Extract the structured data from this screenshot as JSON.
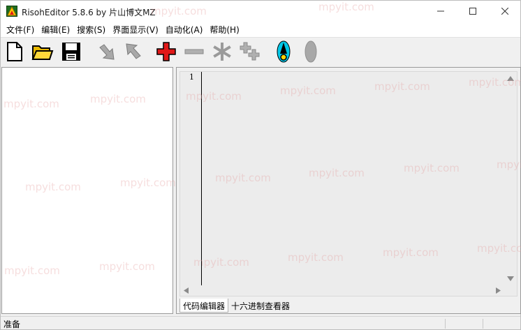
{
  "window": {
    "title": "RisohEditor 5.8.6 by 片山博文MZ"
  },
  "menu": [
    "文件(F)",
    "编辑(E)",
    "搜索(S)",
    "界面显示(V)",
    "自动化(A)",
    "帮助(H)"
  ],
  "editor": {
    "line_numbers": [
      "1"
    ]
  },
  "tabs": [
    "代码编辑器",
    "十六进制查看器"
  ],
  "status": {
    "text": "准备"
  },
  "watermark": "mpyit.com",
  "colors": {
    "accent_red": "#e01818",
    "accent_cyan": "#00c8e8"
  }
}
